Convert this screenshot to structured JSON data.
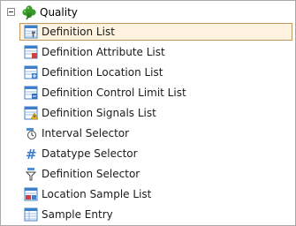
{
  "tree": {
    "root": {
      "label": "Quality",
      "icon": "clover-icon",
      "expanded": true
    },
    "items": [
      {
        "label": "Definition List",
        "icon": "definition-list-icon",
        "selected": true
      },
      {
        "label": "Definition Attribute List",
        "icon": "attribute-list-icon",
        "selected": false
      },
      {
        "label": "Definition Location List",
        "icon": "location-list-icon",
        "selected": false
      },
      {
        "label": "Definition Control Limit List",
        "icon": "control-limit-list-icon",
        "selected": false
      },
      {
        "label": "Definition Signals List",
        "icon": "signals-list-icon",
        "selected": false
      },
      {
        "label": "Interval Selector",
        "icon": "interval-selector-icon",
        "selected": false
      },
      {
        "label": "Datatype Selector",
        "icon": "datatype-selector-icon",
        "selected": false
      },
      {
        "label": "Definition Selector",
        "icon": "definition-selector-icon",
        "selected": false
      },
      {
        "label": "Location Sample List",
        "icon": "location-sample-list-icon",
        "selected": false
      },
      {
        "label": "Sample Entry",
        "icon": "sample-entry-icon",
        "selected": false
      }
    ]
  },
  "colors": {
    "selection_bg": "#fdf3e0",
    "selection_border": "#c19a5b",
    "clover": "#3a9a2a",
    "grid_blue": "#3f7fc8",
    "accent_red": "#d04040",
    "accent_yellow": "#e8b820"
  }
}
